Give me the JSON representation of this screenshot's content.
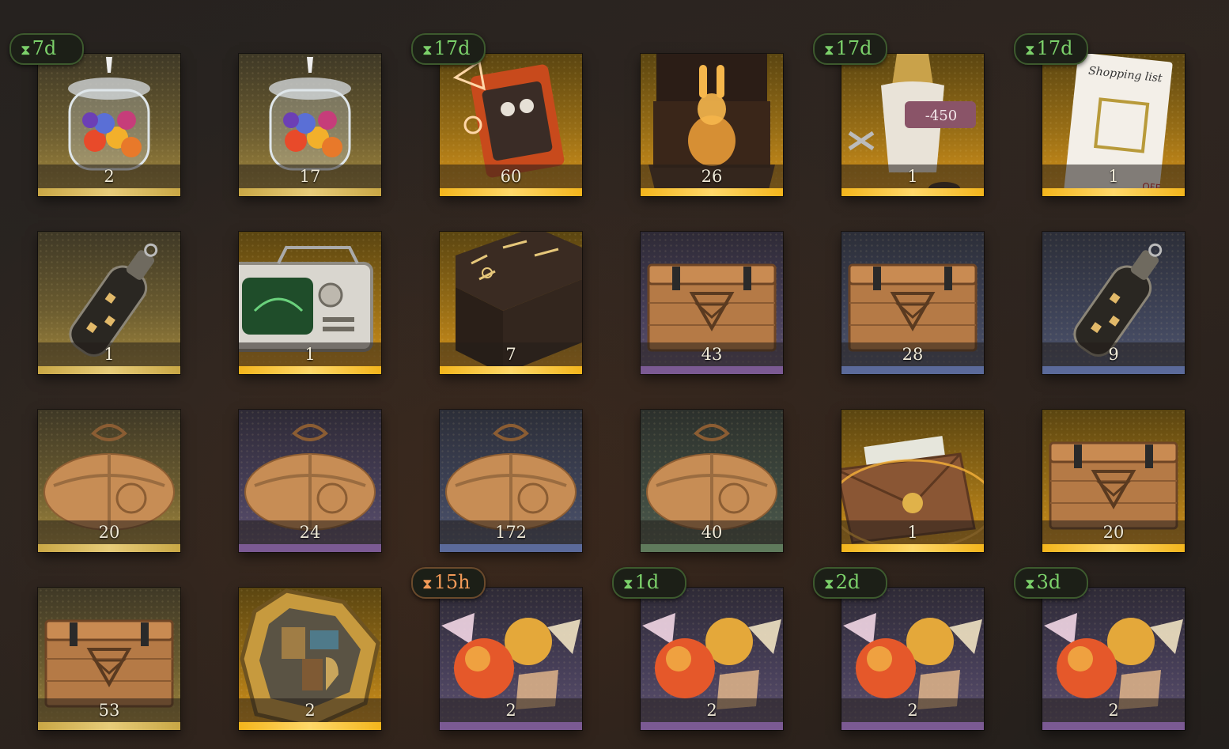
{
  "header": {
    "watermark": ""
  },
  "inventory": {
    "items": [
      {
        "name": "memory-jar",
        "count": "2",
        "rarity": "gold",
        "timer": "7d",
        "timer_tone": "green"
      },
      {
        "name": "memory-jar",
        "count": "17",
        "rarity": "gold",
        "timer": "",
        "timer_tone": ""
      },
      {
        "name": "cassette-tape",
        "count": "60",
        "rarity": "legend",
        "timer": "17d",
        "timer_tone": "green"
      },
      {
        "name": "crystal-rabbit-box",
        "count": "26",
        "rarity": "legend",
        "timer": "",
        "timer_tone": ""
      },
      {
        "name": "tailor-coupon",
        "count": "1",
        "rarity": "legend",
        "timer": "17d",
        "timer_tone": "green",
        "tag": "-450"
      },
      {
        "name": "shopping-list-coupon",
        "count": "1",
        "rarity": "legend",
        "timer": "17d",
        "timer_tone": "green",
        "title": "Shopping list",
        "tag": "OFF"
      },
      {
        "name": "message-bottle",
        "count": "1",
        "rarity": "gold",
        "timer": "",
        "timer_tone": ""
      },
      {
        "name": "retro-tv",
        "count": "1",
        "rarity": "legend",
        "timer": "",
        "timer_tone": ""
      },
      {
        "name": "rune-cabinet",
        "count": "7",
        "rarity": "legend",
        "timer": "",
        "timer_tone": ""
      },
      {
        "name": "wooden-crate",
        "count": "43",
        "rarity": "purple",
        "timer": "",
        "timer_tone": ""
      },
      {
        "name": "wooden-crate",
        "count": "28",
        "rarity": "blue",
        "timer": "",
        "timer_tone": ""
      },
      {
        "name": "message-bottle",
        "count": "9",
        "rarity": "blue",
        "timer": "",
        "timer_tone": ""
      },
      {
        "name": "paper-parcel",
        "count": "20",
        "rarity": "gold",
        "timer": "",
        "timer_tone": ""
      },
      {
        "name": "paper-parcel",
        "count": "24",
        "rarity": "purple",
        "timer": "",
        "timer_tone": ""
      },
      {
        "name": "paper-parcel",
        "count": "172",
        "rarity": "blue",
        "timer": "",
        "timer_tone": ""
      },
      {
        "name": "paper-parcel",
        "count": "40",
        "rarity": "green",
        "timer": "",
        "timer_tone": ""
      },
      {
        "name": "sealed-envelope",
        "count": "1",
        "rarity": "legend",
        "timer": "",
        "timer_tone": ""
      },
      {
        "name": "wooden-crate",
        "count": "20",
        "rarity": "legend",
        "timer": "",
        "timer_tone": ""
      },
      {
        "name": "wooden-crate",
        "count": "53",
        "rarity": "gold",
        "timer": "",
        "timer_tone": ""
      },
      {
        "name": "puzzle-box",
        "count": "2",
        "rarity": "legend",
        "timer": "",
        "timer_tone": ""
      },
      {
        "name": "candy",
        "count": "2",
        "rarity": "purple",
        "timer": "15h",
        "timer_tone": "orange"
      },
      {
        "name": "candy",
        "count": "2",
        "rarity": "purple",
        "timer": "1d",
        "timer_tone": "green"
      },
      {
        "name": "candy",
        "count": "2",
        "rarity": "purple",
        "timer": "2d",
        "timer_tone": "green"
      },
      {
        "name": "candy",
        "count": "2",
        "rarity": "purple",
        "timer": "3d",
        "timer_tone": "green"
      }
    ],
    "hourglass_glyph": "⧗"
  },
  "colors": {
    "legend_bar": "#f3b51c",
    "gold_bar": "#c9a745",
    "purple_bar": "#7b5a93",
    "blue_bar": "#5b6a9a",
    "green_bar": "#5f7a5c",
    "timer_green": "#7bd06a",
    "timer_orange": "#f29a58"
  }
}
